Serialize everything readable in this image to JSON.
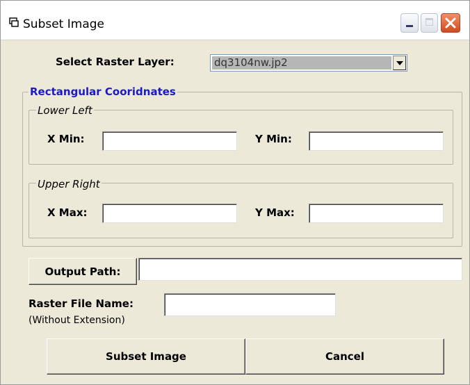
{
  "window": {
    "title": "Subset Image"
  },
  "select_raster": {
    "label": "Select Raster Layer:",
    "value": "dq3104nw.jp2"
  },
  "rect_coords": {
    "legend": "Rectangular Cooridnates",
    "lower_left": {
      "legend": "Lower Left",
      "x_min_label": "X Min:",
      "y_min_label": "Y Min:",
      "x_min_value": "",
      "y_min_value": ""
    },
    "upper_right": {
      "legend": "Upper Right",
      "x_max_label": "X Max:",
      "y_max_label": "Y Max:",
      "x_max_value": "",
      "y_max_value": ""
    }
  },
  "output": {
    "button_label": "Output Path:",
    "value": ""
  },
  "raster_file": {
    "label": "Raster File Name:",
    "hint": "(Without Extension)",
    "value": ""
  },
  "actions": {
    "subset_label": "Subset Image",
    "cancel_label": "Cancel"
  }
}
